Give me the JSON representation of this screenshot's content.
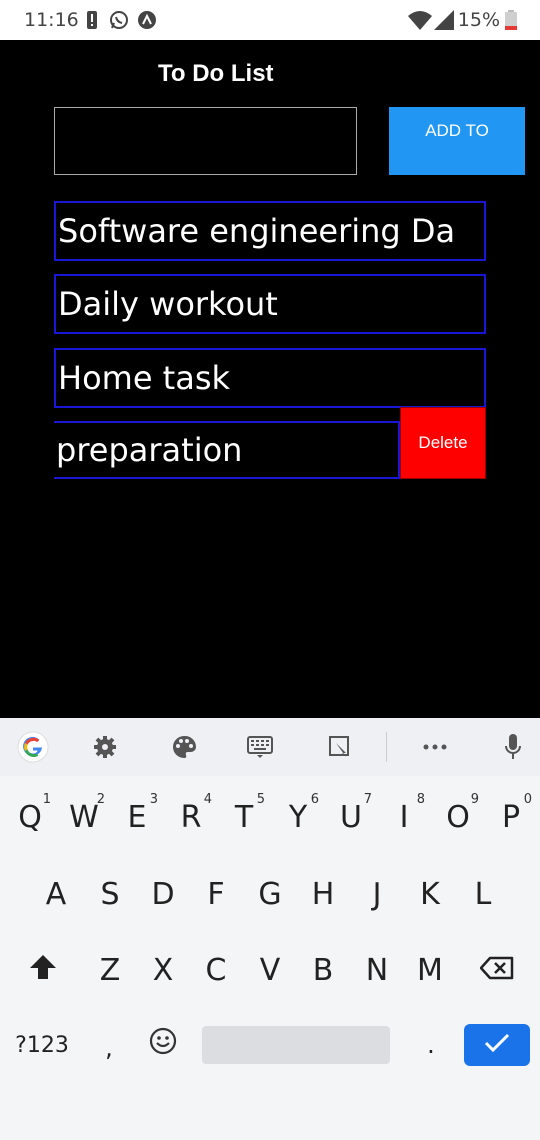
{
  "status_bar": {
    "time": "11:16",
    "battery": "15%",
    "icons": [
      "alert-icon",
      "whatsapp-icon",
      "app-icon",
      "wifi-icon",
      "signal-icon",
      "battery-icon"
    ]
  },
  "app": {
    "title": "To Do List",
    "input": {
      "value": "",
      "placeholder": ""
    },
    "add_button": "ADD TO",
    "items": [
      {
        "text": "Software engineering Da"
      },
      {
        "text": "Daily workout"
      },
      {
        "text": "Home task"
      },
      {
        "text": "preparation"
      }
    ],
    "delete_label": "Delete",
    "colors": {
      "item_border": "#1a16d6",
      "add_button": "#2196F3",
      "delete": "#ff0000"
    }
  },
  "keyboard": {
    "toolbar_icons": [
      "google-icon",
      "settings-icon",
      "palette-icon",
      "keyboard-icon",
      "clipboard-icon",
      "more-icon",
      "mic-icon"
    ],
    "row1": [
      {
        "key": "Q",
        "hint": "1"
      },
      {
        "key": "W",
        "hint": "2"
      },
      {
        "key": "E",
        "hint": "3"
      },
      {
        "key": "R",
        "hint": "4"
      },
      {
        "key": "T",
        "hint": "5"
      },
      {
        "key": "Y",
        "hint": "6"
      },
      {
        "key": "U",
        "hint": "7"
      },
      {
        "key": "I",
        "hint": "8"
      },
      {
        "key": "O",
        "hint": "9"
      },
      {
        "key": "P",
        "hint": "0"
      }
    ],
    "row2": [
      "A",
      "S",
      "D",
      "F",
      "G",
      "H",
      "J",
      "K",
      "L"
    ],
    "row3": [
      "Z",
      "X",
      "C",
      "V",
      "B",
      "N",
      "M"
    ],
    "symbols_key": "?123",
    "comma_key": ",",
    "period_key": "."
  }
}
